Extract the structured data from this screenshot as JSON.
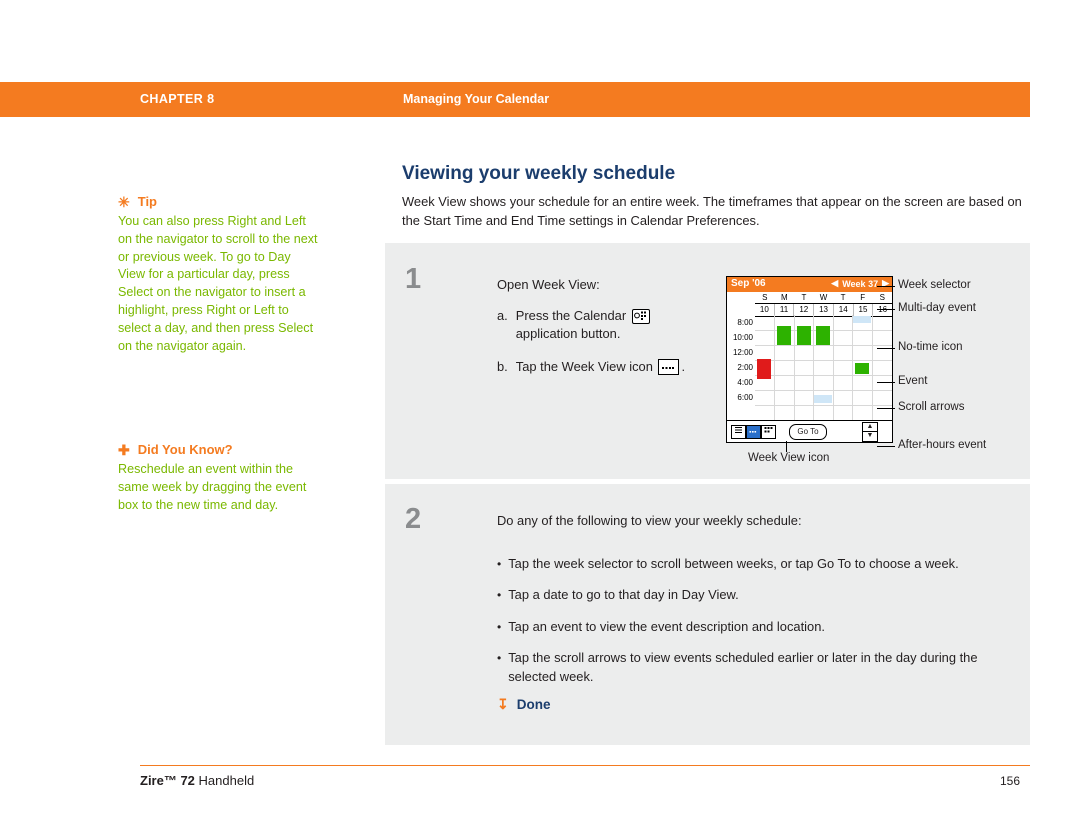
{
  "header": {
    "chapter": "CHAPTER 8",
    "section": "Managing Your Calendar",
    "band_color": "#f47b20"
  },
  "sidebar": {
    "tip": {
      "glyph": "✳",
      "title": "Tip",
      "body": "You can also press Right and Left on the navigator to scroll to the next or previous week. To go to Day View for a particular day, press Select on the navigator to insert a highlight, press Right or Left to select a day, and then press Select on the navigator again."
    },
    "did_you_know": {
      "glyph": "✚",
      "title": "Did You Know?",
      "body": "Reschedule an event within the same week by dragging the event box to the new time and day."
    },
    "tip_color": "#f47b20",
    "body_color": "#7ab800"
  },
  "main": {
    "title": "Viewing your weekly schedule",
    "intro": "Week View shows your schedule for an entire week. The timeframes that appear on the screen are based on the Start Time and End Time settings in Calendar Preferences.",
    "step1": {
      "number": "1",
      "lead": "Open Week View:",
      "a_label": "a.",
      "a_text_before": "Press the Calendar",
      "a_text_after": "application button.",
      "b_label": "b.",
      "b_text_before": "Tap the Week View icon",
      "b_text_after": "."
    },
    "step2": {
      "number": "2",
      "lead": "Do any of the following to view your weekly schedule:",
      "bullets": [
        "Tap the week selector to scroll between weeks, or tap Go To to choose a week.",
        "Tap a date to go to that day in Day View.",
        "Tap an event to view the event description and location.",
        "Tap the scroll arrows to view events scheduled earlier or later in the day during the selected week."
      ],
      "done_label": "Done"
    }
  },
  "device": {
    "month": "Sep '06",
    "week_label": "Week 37",
    "prev_arrow": "◀",
    "next_arrow": "▶",
    "days": [
      "S",
      "M",
      "T",
      "W",
      "T",
      "F",
      "S"
    ],
    "dates": [
      "10",
      "11",
      "12",
      "13",
      "14",
      "15",
      "16"
    ],
    "times": [
      "8:00",
      "10:00",
      "12:00",
      "2:00",
      "4:00",
      "6:00"
    ],
    "goto_label": "Go To",
    "caption": "Week View icon"
  },
  "callouts": [
    "Week selector",
    "Multi-day event",
    "No-time icon",
    "Event",
    "Scroll arrows",
    "After-hours event"
  ],
  "footer": {
    "product": "Zire™ 72",
    "product_suffix": " Handheld",
    "page": "156",
    "rule_color": "#f47b20"
  }
}
